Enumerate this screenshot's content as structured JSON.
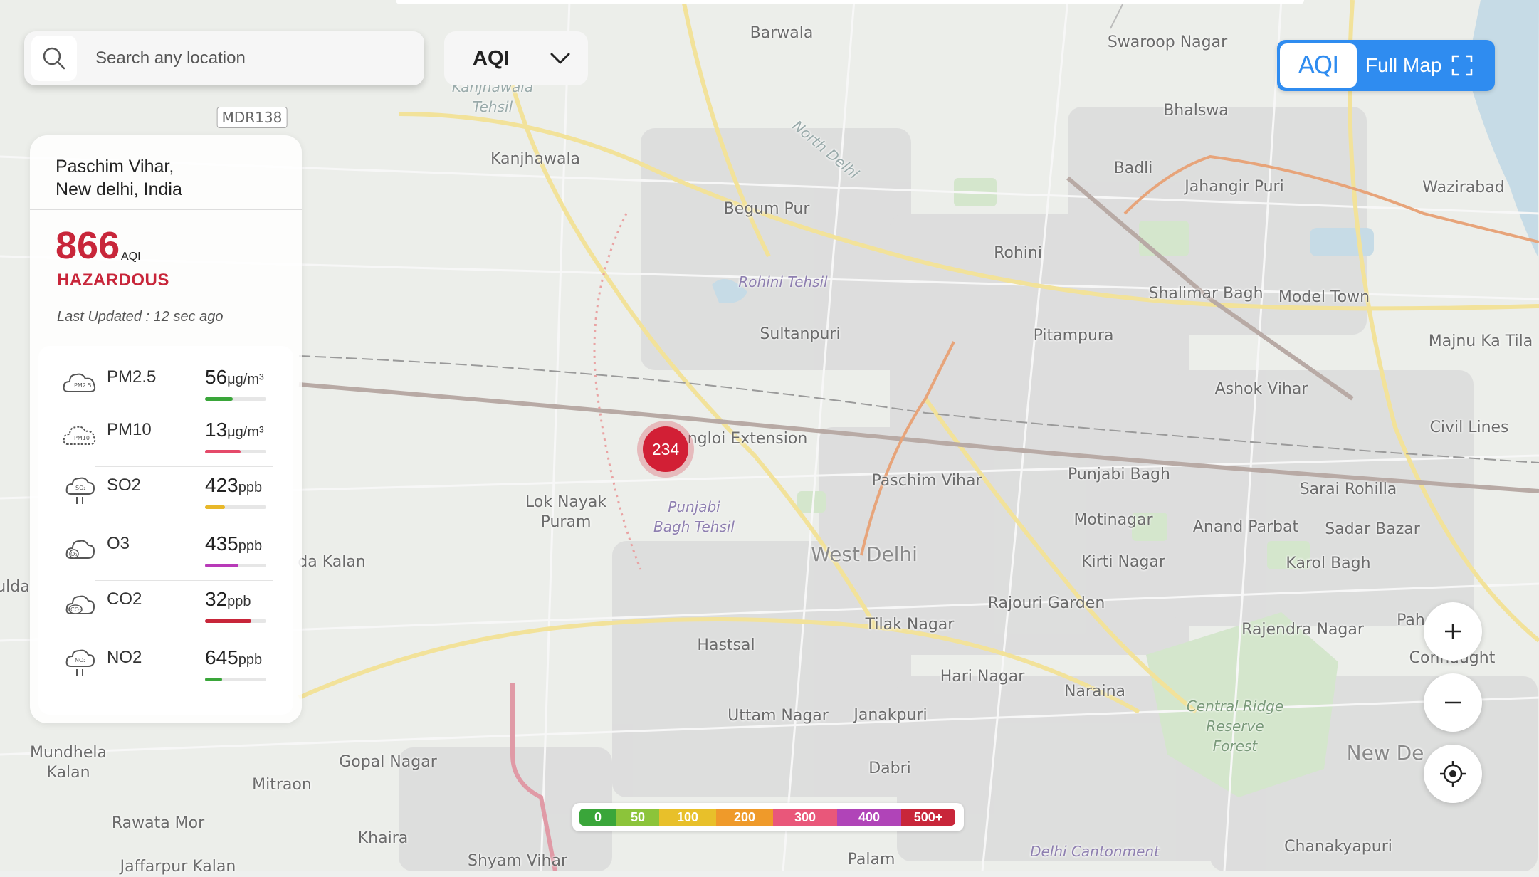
{
  "search": {
    "placeholder": "Search any location"
  },
  "metric_select": {
    "value": "AQI"
  },
  "full_map": {
    "logo": "AQI",
    "label": "Full Map"
  },
  "location": {
    "line1": "Paschim Vihar,",
    "line2": "New delhi, India"
  },
  "aqi": {
    "value": "866",
    "unit": "AQI",
    "category": "HAZARDOUS",
    "last_updated": "Last Updated : 12 sec ago"
  },
  "pollutants": [
    {
      "name": "PM2.5",
      "value": "56",
      "unit": "μg/m³",
      "level": 0.45,
      "color": "#3aa63a"
    },
    {
      "name": "PM10",
      "value": "13",
      "unit": "μg/m³",
      "level": 0.58,
      "color": "#e54a6a"
    },
    {
      "name": "SO2",
      "value": "423",
      "unit": "ppb",
      "level": 0.32,
      "color": "#e8b82a"
    },
    {
      "name": "O3",
      "value": "435",
      "unit": "ppb",
      "level": 0.55,
      "color": "#b83ab8"
    },
    {
      "name": "CO2",
      "value": "32",
      "unit": "ppb",
      "level": 0.75,
      "color": "#c8263a"
    },
    {
      "name": "NO2",
      "value": "645",
      "unit": "ppb",
      "level": 0.28,
      "color": "#3aa63a"
    }
  ],
  "marker": {
    "value": "234"
  },
  "legend": [
    {
      "label": "0",
      "color": "#3aa63a"
    },
    {
      "label": "50",
      "color": "#8cc43a"
    },
    {
      "label": "100",
      "color": "#e8c02a"
    },
    {
      "label": "200",
      "color": "#ef9a2a"
    },
    {
      "label": "300",
      "color": "#e9577a"
    },
    {
      "label": "400",
      "color": "#b044b8"
    },
    {
      "label": "500+",
      "color": "#c8263a"
    }
  ],
  "map_labels": {
    "barwala": "Barwala",
    "swaroop_nagar": "Swaroop Nagar",
    "bhalswa": "Bhalswa",
    "mdr138": "MDR138",
    "kanjhawala_tehsil": "Kanjhawala Tehsil",
    "kanjhawala": "Kanjhawala",
    "north_delhi": "North Delhi",
    "badli": "Badli",
    "jahangir_puri": "Jahangir Puri",
    "wazirabad": "Wazirabad",
    "begum_pur": "Begum Pur",
    "rohini": "Rohini",
    "rohini_tehsil": "Rohini Tehsil",
    "shalimar_bagh": "Shalimar Bagh",
    "model_town": "Model Town",
    "sultanpuri": "Sultanpuri",
    "pitampura": "Pitampura",
    "majnu_ka_tila": "Majnu Ka Tila",
    "ashok_vihar": "Ashok Vihar",
    "civil_lines": "Civil Lines",
    "nangloi_extension": "ngloi Extension",
    "paschim_vihar": "Paschim Vihar",
    "punjabi_bagh": "Punjabi Bagh",
    "sarai_rohilla": "Sarai Rohilla",
    "lok_nayak_puram": "Lok Nayak Puram",
    "punjabi_bagh_tehsil": "Punjabi Bagh Tehsil",
    "motinagar": "Motinagar",
    "anand_parbat": "Anand Parbat",
    "sadar_bazar": "Sadar Bazar",
    "west_delhi": "West Delhi",
    "kirti_nagar": "Kirti Nagar",
    "karol_bagh": "Karol Bagh",
    "da_kalan": "da Kalan",
    "ulda": "ulda",
    "rajouri_garden": "Rajouri Garden",
    "tilak_nagar": "Tilak Nagar",
    "rajendra_nagar": "Rajendra Nagar",
    "pah": "Pah",
    "hastsal": "Hastsal",
    "hari_nagar": "Hari Nagar",
    "connaught": "Connaught",
    "naraina": "Naraina",
    "central_ridge": "Central Ridge Reserve Forest",
    "uttam_nagar": "Uttam Nagar",
    "janakpuri": "Janakpuri",
    "mundhela_kalan": "Mundhela Kalan",
    "gopal_nagar": "Gopal Nagar",
    "new_delhi": "New De",
    "dabri": "Dabri",
    "mitraon": "Mitraon",
    "rawata_mor": "Rawata Mor",
    "khaira": "Khaira",
    "delhi_cantonment": "Delhi Cantonment",
    "chanakyapuri": "Chanakyapuri",
    "shyam_vihar": "Shyam Vihar",
    "palam": "Palam",
    "jaffarpur_kalan": "Jaffarpur Kalan"
  }
}
